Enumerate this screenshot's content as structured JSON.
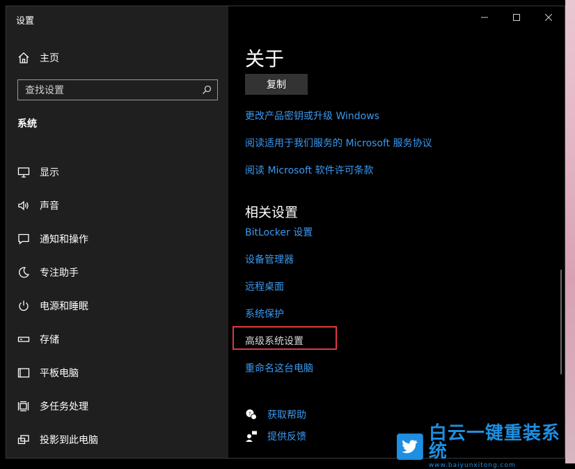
{
  "window": {
    "title": "设置"
  },
  "sidebar": {
    "home_label": "主页",
    "search_placeholder": "查找设置",
    "section_label": "系统",
    "items": [
      {
        "label": "显示",
        "icon": "monitor-icon"
      },
      {
        "label": "声音",
        "icon": "speaker-icon"
      },
      {
        "label": "通知和操作",
        "icon": "notification-icon"
      },
      {
        "label": "专注助手",
        "icon": "moon-icon"
      },
      {
        "label": "电源和睡眠",
        "icon": "power-icon"
      },
      {
        "label": "存储",
        "icon": "storage-icon"
      },
      {
        "label": "平板电脑",
        "icon": "tablet-icon"
      },
      {
        "label": "多任务处理",
        "icon": "multitask-icon"
      },
      {
        "label": "投影到此电脑",
        "icon": "project-icon"
      }
    ]
  },
  "main": {
    "heading": "关于",
    "copy_button": "复制",
    "links": [
      "更改产品密钥或升级 Windows",
      "阅读适用于我们服务的 Microsoft 服务协议",
      "阅读 Microsoft 软件许可条款"
    ],
    "related_heading": "相关设置",
    "related_links": [
      "BitLocker 设置",
      "设备管理器",
      "远程桌面",
      "系统保护",
      "高级系统设置",
      "重命名这台电脑"
    ],
    "help": [
      {
        "label": "获取帮助",
        "icon": "help-chat-icon"
      },
      {
        "label": "提供反馈",
        "icon": "feedback-icon"
      }
    ]
  },
  "watermark": {
    "cn": "白云一键重装系统",
    "en": "www.baiyunxitong.com"
  },
  "colors": {
    "link": "#3b99f0",
    "highlight": "#e0393e",
    "sidebar": "#1f1f1f"
  }
}
